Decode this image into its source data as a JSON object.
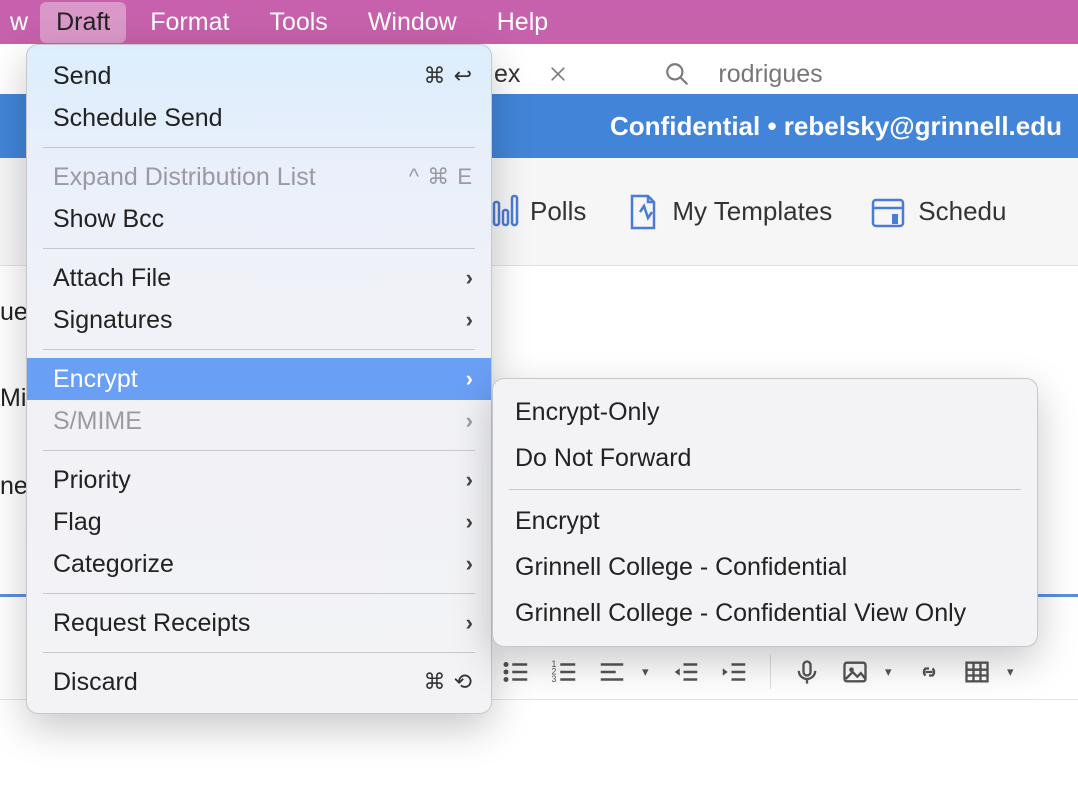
{
  "menubar": {
    "items": [
      {
        "label": "w"
      },
      {
        "label": "Draft"
      },
      {
        "label": "Format"
      },
      {
        "label": "Tools"
      },
      {
        "label": "Window"
      },
      {
        "label": "Help"
      }
    ],
    "selected_index": 1
  },
  "confidential": {
    "text": "Confidential • rebelsky@grinnell.edu"
  },
  "tab_peek": {
    "tab_suffix": "ex",
    "search_text": "rodrigues"
  },
  "ribbon": {
    "tools": [
      {
        "name": "polls",
        "label": "Polls",
        "icon": "polls-icon"
      },
      {
        "name": "my-templates",
        "label": "My Templates",
        "icon": "template-icon"
      },
      {
        "name": "scheduling",
        "label": "Schedu",
        "icon": "schedule-icon"
      }
    ]
  },
  "fragments": {
    "ue": "ue",
    "mi": "Mic",
    "ne": "ne"
  },
  "draft_menu": {
    "groups": [
      [
        {
          "label": "Send",
          "shortcut": "⌘ ↩",
          "has_submenu": false,
          "enabled": true,
          "id": "send"
        },
        {
          "label": "Schedule Send",
          "shortcut": "",
          "has_submenu": false,
          "enabled": true,
          "id": "schedule-send"
        }
      ],
      [
        {
          "label": "Expand Distribution List",
          "shortcut": "^ ⌘ E",
          "has_submenu": false,
          "enabled": false,
          "id": "expand-dl"
        },
        {
          "label": "Show Bcc",
          "shortcut": "",
          "has_submenu": false,
          "enabled": true,
          "id": "show-bcc"
        }
      ],
      [
        {
          "label": "Attach File",
          "shortcut": "",
          "has_submenu": true,
          "enabled": true,
          "id": "attach-file"
        },
        {
          "label": "Signatures",
          "shortcut": "",
          "has_submenu": true,
          "enabled": true,
          "id": "signatures"
        }
      ],
      [
        {
          "label": "Encrypt",
          "shortcut": "",
          "has_submenu": true,
          "enabled": true,
          "id": "encrypt",
          "highlighted": true
        },
        {
          "label": "S/MIME",
          "shortcut": "",
          "has_submenu": true,
          "enabled": false,
          "id": "smime"
        }
      ],
      [
        {
          "label": "Priority",
          "shortcut": "",
          "has_submenu": true,
          "enabled": true,
          "id": "priority"
        },
        {
          "label": "Flag",
          "shortcut": "",
          "has_submenu": true,
          "enabled": true,
          "id": "flag"
        },
        {
          "label": "Categorize",
          "shortcut": "",
          "has_submenu": true,
          "enabled": true,
          "id": "categorize"
        }
      ],
      [
        {
          "label": "Request Receipts",
          "shortcut": "",
          "has_submenu": true,
          "enabled": true,
          "id": "request-receipts"
        }
      ],
      [
        {
          "label": "Discard",
          "shortcut": "⌘ ⟲",
          "has_submenu": false,
          "enabled": true,
          "id": "discard"
        }
      ]
    ]
  },
  "encrypt_submenu": {
    "groups": [
      [
        {
          "label": "Encrypt-Only",
          "id": "encrypt-only"
        },
        {
          "label": "Do Not Forward",
          "id": "do-not-forward"
        }
      ],
      [
        {
          "label": "Encrypt",
          "id": "encrypt-label"
        },
        {
          "label": "Grinnell College - Confidential",
          "id": "gc-confidential"
        },
        {
          "label": "Grinnell College - Confidential View Only",
          "id": "gc-confidential-view"
        }
      ]
    ]
  },
  "format_bar": {
    "icons": [
      {
        "name": "bulleted-list-icon"
      },
      {
        "name": "numbered-list-icon"
      },
      {
        "name": "align-left-icon",
        "has_caret": true
      },
      {
        "name": "outdent-icon"
      },
      {
        "name": "indent-icon"
      },
      {
        "separator": true
      },
      {
        "name": "microphone-icon"
      },
      {
        "name": "image-icon",
        "has_caret": true
      },
      {
        "name": "link-icon"
      },
      {
        "name": "table-icon",
        "has_caret": true
      }
    ]
  }
}
